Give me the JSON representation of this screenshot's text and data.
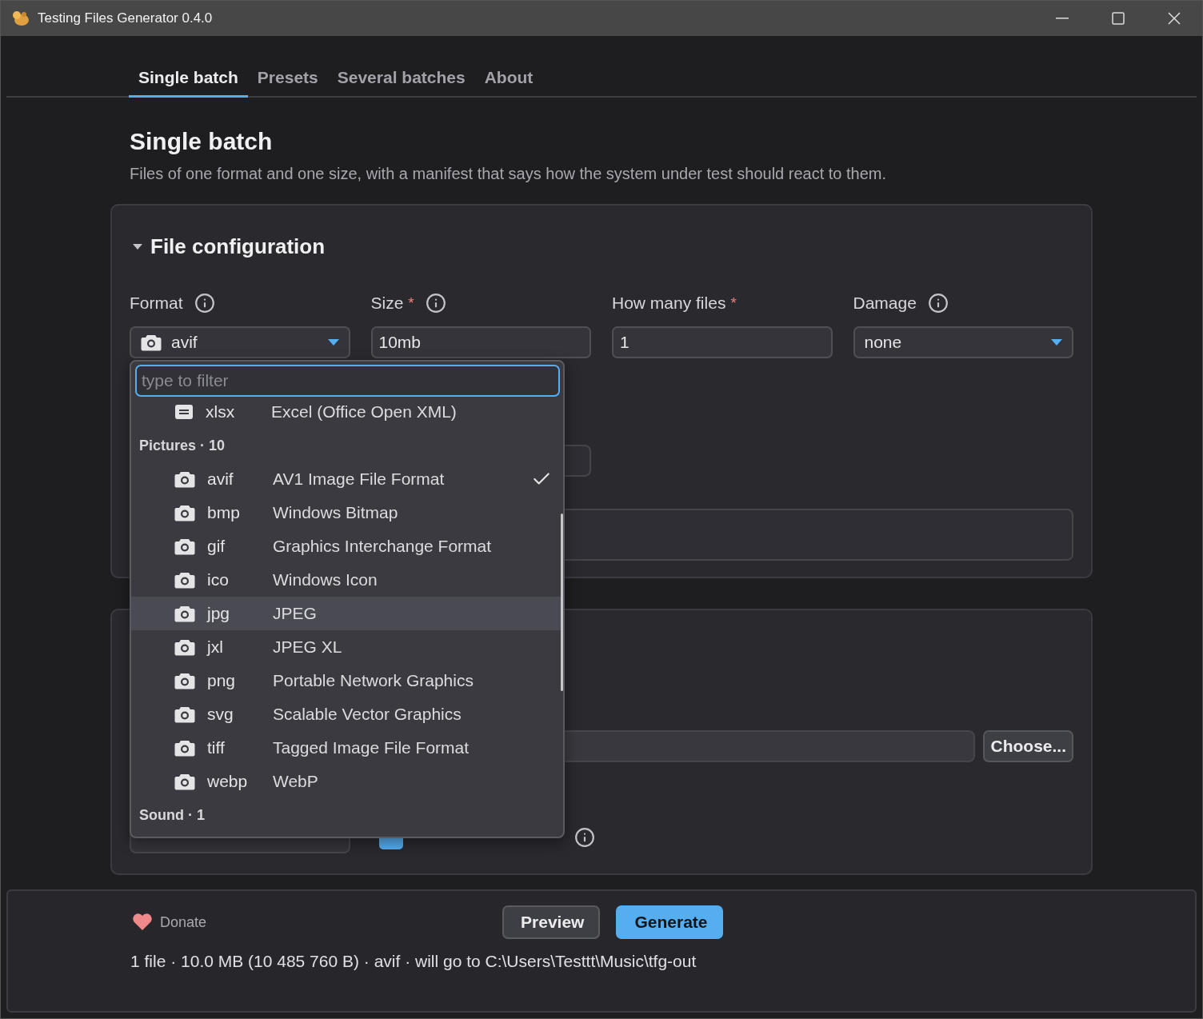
{
  "window": {
    "title": "Testing Files Generator 0.4.0"
  },
  "tabs": [
    {
      "label": "Single batch",
      "selected": true
    },
    {
      "label": "Presets",
      "selected": false
    },
    {
      "label": "Several batches",
      "selected": false
    },
    {
      "label": "About",
      "selected": false
    }
  ],
  "page": {
    "title": "Single batch",
    "description": "Files of one format and one size, with a manifest that says how the system under test should react to them."
  },
  "file_configuration": {
    "title": "File configuration",
    "expanded": true,
    "fields": [
      {
        "kind": "format_select",
        "label": "Format",
        "info": true,
        "value": "avif"
      },
      {
        "kind": "text",
        "label": "Size",
        "required_mark": "*",
        "info": true,
        "value": "10mb"
      },
      {
        "kind": "text",
        "label": "How many files",
        "required_mark": "*",
        "info": false,
        "value": "1"
      },
      {
        "kind": "select",
        "label": "Damage",
        "info": true,
        "value": "none"
      }
    ]
  },
  "format_menu": {
    "filter_placeholder": "type to filter",
    "items": [
      {
        "kind": "document",
        "extension": "xlsx",
        "description": "Excel (Office Open XML)",
        "selected": false,
        "highlighted": false
      },
      {
        "kind": "header",
        "label": "Pictures · 10"
      },
      {
        "kind": "picture",
        "extension": "avif",
        "description": "AV1 Image File Format",
        "selected": true,
        "highlighted": false
      },
      {
        "kind": "picture",
        "extension": "bmp",
        "description": "Windows Bitmap",
        "selected": false,
        "highlighted": false
      },
      {
        "kind": "picture",
        "extension": "gif",
        "description": "Graphics Interchange Format",
        "selected": false,
        "highlighted": false
      },
      {
        "kind": "picture",
        "extension": "ico",
        "description": "Windows Icon",
        "selected": false,
        "highlighted": false
      },
      {
        "kind": "picture",
        "extension": "jpg",
        "description": "JPEG",
        "selected": false,
        "highlighted": true
      },
      {
        "kind": "picture",
        "extension": "jxl",
        "description": "JPEG XL",
        "selected": false,
        "highlighted": false
      },
      {
        "kind": "picture",
        "extension": "png",
        "description": "Portable Network Graphics",
        "selected": false,
        "highlighted": false
      },
      {
        "kind": "picture",
        "extension": "svg",
        "description": "Scalable Vector Graphics",
        "selected": false,
        "highlighted": false
      },
      {
        "kind": "picture",
        "extension": "tiff",
        "description": "Tagged Image File Format",
        "selected": false,
        "highlighted": false
      },
      {
        "kind": "picture",
        "extension": "webp",
        "description": "WebP",
        "selected": false,
        "highlighted": false
      },
      {
        "kind": "header",
        "label": "Sound · 1"
      }
    ]
  },
  "output": {
    "button": "Choose...",
    "checkbox": {
      "checked": true,
      "info": true
    }
  },
  "footer": {
    "donate": "Donate",
    "buttons": [
      {
        "label": "Preview",
        "kind": "secondary"
      },
      {
        "label": "Generate",
        "kind": "primary"
      }
    ],
    "summary": "1 file · 10.0 MB (10 485 760 B) · avif · will go to C:\\Users\\Testtt\\Music\\tfg-out"
  }
}
